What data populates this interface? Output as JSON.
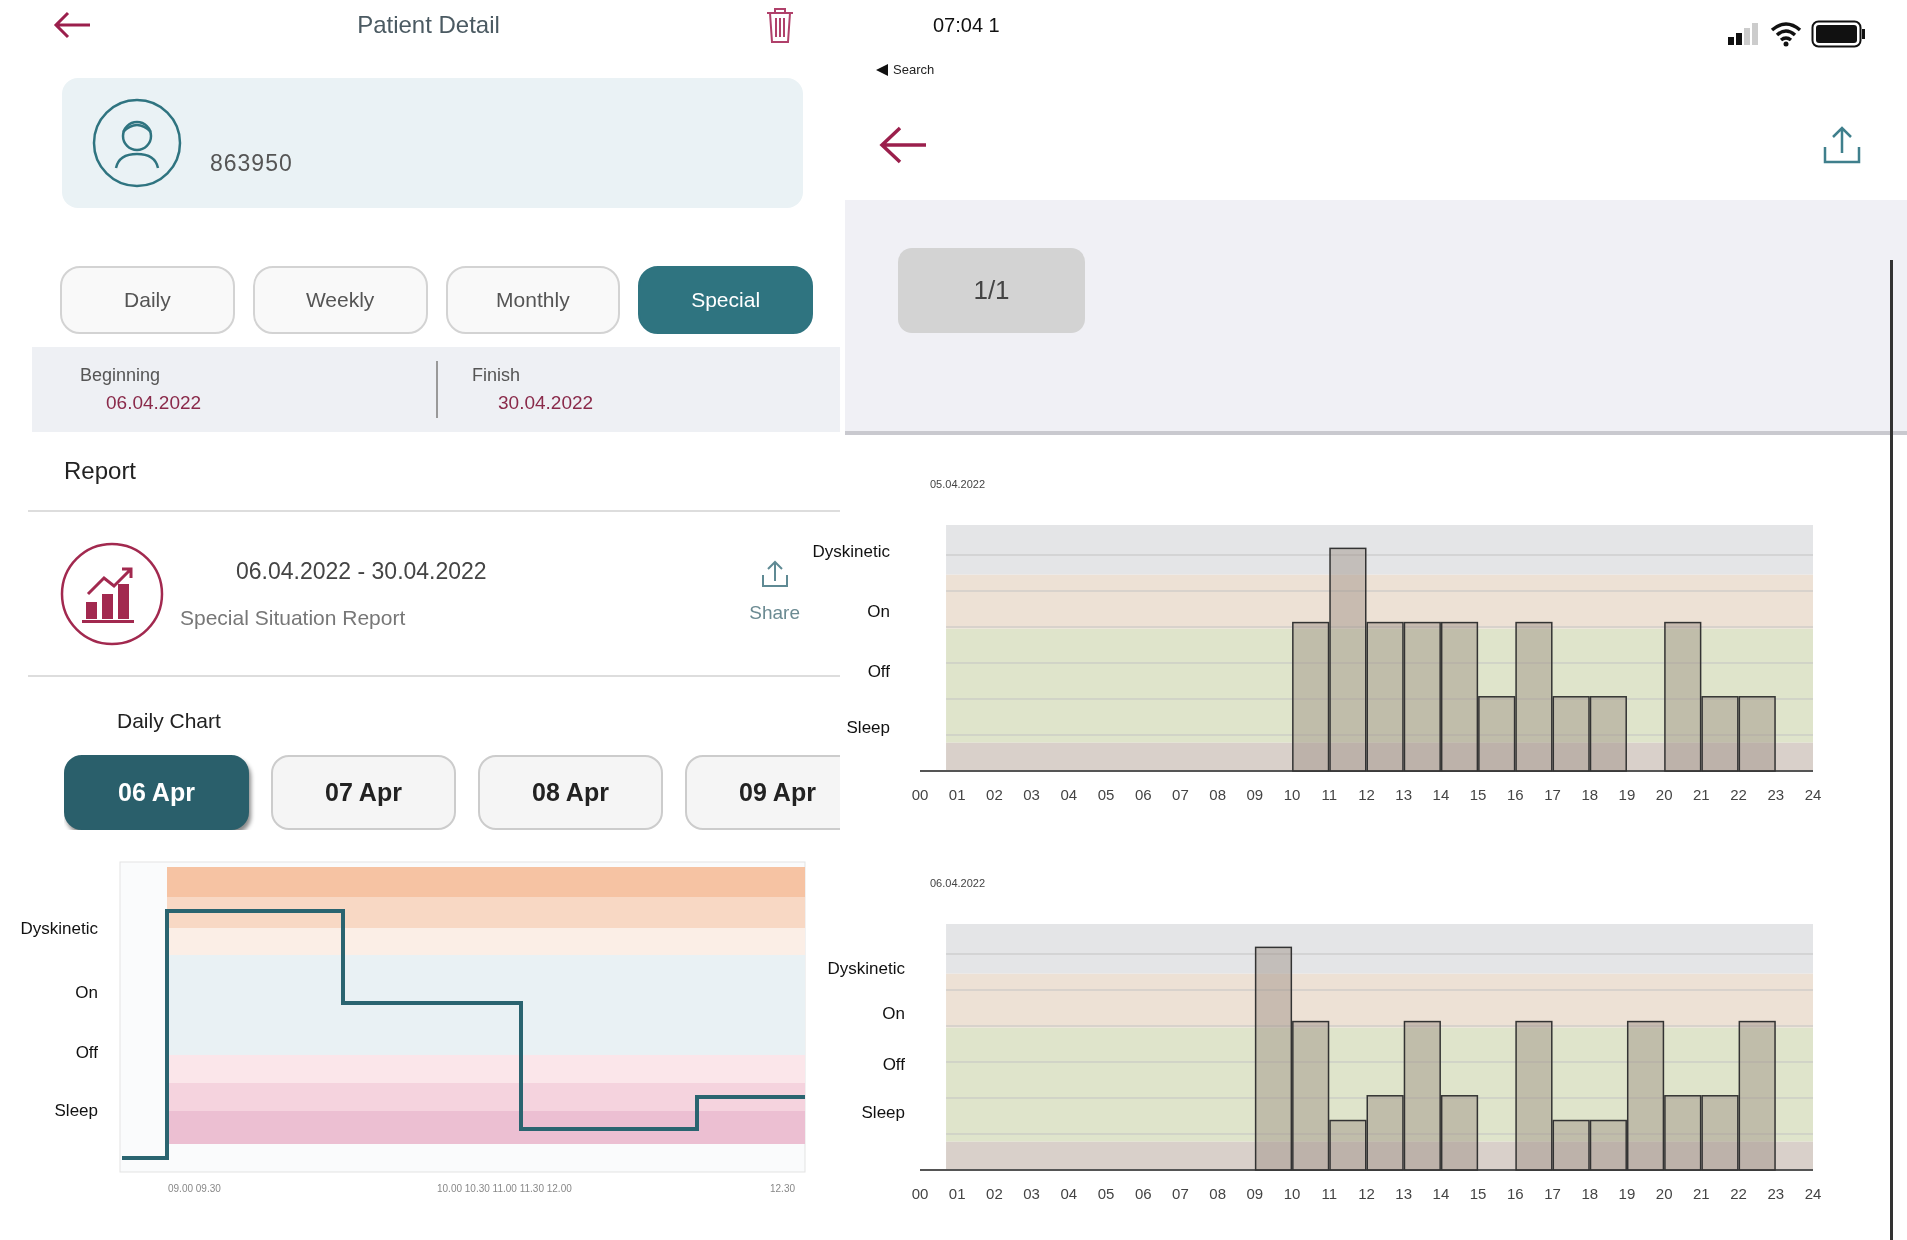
{
  "left_panel": {
    "header": {
      "title": "Patient Detail"
    },
    "patient": {
      "id": "863950"
    },
    "period_tabs": [
      {
        "label": "Daily",
        "selected": false
      },
      {
        "label": "Weekly",
        "selected": false
      },
      {
        "label": "Monthly",
        "selected": false
      },
      {
        "label": "Special",
        "selected": true
      }
    ],
    "date_range": {
      "beginning_label": "Beginning",
      "beginning": "06.04.2022",
      "finish_label": "Finish",
      "finish": "30.04.2022"
    },
    "report_heading": "Report",
    "report": {
      "range": "06.04.2022 - 30.04.2022",
      "title": "Special Situation Report",
      "share_label": "Share"
    },
    "daily_chart": {
      "heading": "Daily Chart",
      "days": [
        {
          "label": "06 Apr",
          "selected": true
        },
        {
          "label": "07 Apr",
          "selected": false
        },
        {
          "label": "08 Apr",
          "selected": false
        },
        {
          "label": "09 Apr",
          "selected": false
        }
      ],
      "y_labels": [
        "Dyskinetic",
        "On",
        "Off",
        "Sleep"
      ],
      "x_labels": [
        "09.00 09.30",
        "10.00 10.30 11.00 11.30 12.00",
        "12.30"
      ]
    }
  },
  "right_panel": {
    "status_bar": {
      "time": "07:04 1",
      "back_label": "Search"
    },
    "page_indicator": "1/1",
    "charts": [
      {
        "date": "05.04.2022",
        "y_labels": [
          "Dyskinetic",
          "On",
          "Off",
          "Sleep"
        ],
        "x_labels": [
          "00",
          "01",
          "02",
          "03",
          "04",
          "05",
          "06",
          "07",
          "08",
          "09",
          "10",
          "11",
          "12",
          "13",
          "14",
          "15",
          "16",
          "17",
          "18",
          "19",
          "20",
          "21",
          "22",
          "23",
          "24"
        ]
      },
      {
        "date": "06.04.2022",
        "y_labels": [
          "Dyskinetic",
          "On",
          "Off",
          "Sleep"
        ],
        "x_labels": [
          "00",
          "01",
          "02",
          "03",
          "04",
          "05",
          "06",
          "07",
          "08",
          "09",
          "10",
          "11",
          "12",
          "13",
          "14",
          "15",
          "16",
          "17",
          "18",
          "19",
          "20",
          "21",
          "22",
          "23",
          "24"
        ]
      }
    ]
  }
}
